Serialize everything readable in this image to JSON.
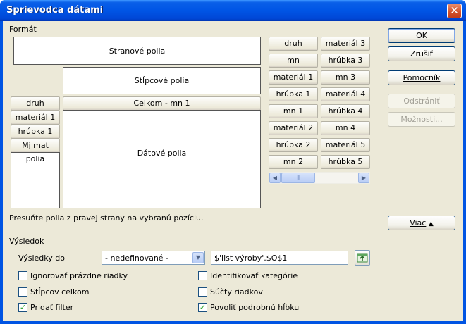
{
  "window": {
    "title": "Sprievodca dátami",
    "close": "✕"
  },
  "format": {
    "group_label": "Formát",
    "page_area": "Stranové polia",
    "column_area": "Stĺpcové polia",
    "data_area": "Dátové polia",
    "data_field": "Celkom - mn 1",
    "row_area": "polia",
    "row_fields": [
      "druh",
      "materiál 1",
      "hrúbka 1",
      "Mj mat"
    ],
    "available_fields": [
      [
        "druh",
        "materiál 3"
      ],
      [
        "mn",
        "hrúbka 3"
      ],
      [
        "materiál 1",
        "mn 3"
      ],
      [
        "hrúbka 1",
        "materiál 4"
      ],
      [
        "mn 1",
        "hrúbka 4"
      ],
      [
        "materiál 2",
        "mn 4"
      ],
      [
        "hrúbka 2",
        "materiál 5"
      ],
      [
        "mn 2",
        "hrúbka 5"
      ]
    ],
    "thumb_grip": "III",
    "hint": "Presuňte polia z pravej strany na vybranú pozíciu."
  },
  "buttons": {
    "ok": "OK",
    "cancel": "Zrušiť",
    "help": "Pomocník",
    "remove": "Odstrániť",
    "options": "Možnosti...",
    "more": "Viac"
  },
  "result": {
    "group_label": "Výsledok",
    "results_to_label": "Výsledky do",
    "destination_select": "- nedefinované -",
    "destination_value": "$'list výroby'.$O$1"
  },
  "checkboxes": [
    {
      "label": "Ignorovať prázdne riadky",
      "checked": false
    },
    {
      "label": "Identifikovať kategórie",
      "checked": false
    },
    {
      "label": "Stĺpcov celkom",
      "checked": false
    },
    {
      "label": "Súčty riadkov",
      "checked": false
    },
    {
      "label": "Pridať filter",
      "checked": true
    },
    {
      "label": "Povoliť podrobnú hĺbku",
      "checked": true
    }
  ],
  "colors": {
    "title_bar": "#0055e5",
    "dialog_bg": "#ece9d8",
    "check_mark": "#21a121"
  }
}
